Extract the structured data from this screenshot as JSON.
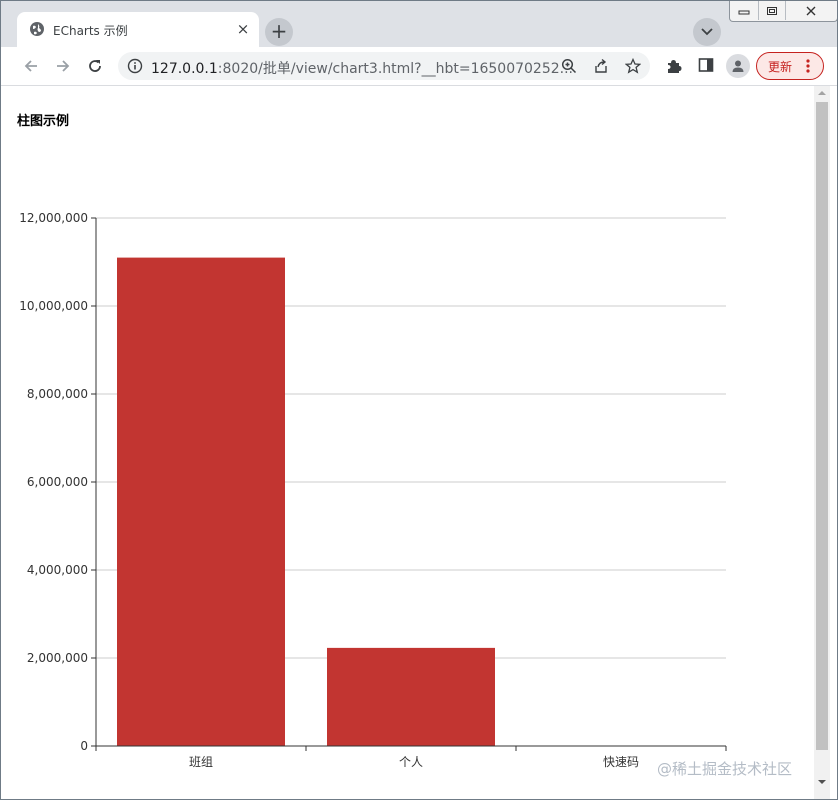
{
  "browser": {
    "tab_title": "ECharts 示例",
    "new_tab_label": "+",
    "close_tab_label": "×",
    "url_host": "127.0.0.1",
    "url_rest": ":8020/批单/view/chart3.html?__hbt=1650070252...",
    "update_label": "更新"
  },
  "page": {
    "heading": "柱图示例"
  },
  "chart_data": {
    "type": "bar",
    "categories": [
      "班组",
      "个人",
      "快速码"
    ],
    "values": [
      11100000,
      2230000,
      0
    ],
    "ylim": [
      0,
      12000000
    ],
    "yticks": [
      0,
      2000000,
      4000000,
      6000000,
      8000000,
      10000000,
      12000000
    ],
    "ytick_labels": [
      "0",
      "2,000,000",
      "4,000,000",
      "6,000,000",
      "8,000,000",
      "10,000,000",
      "12,000,000"
    ],
    "grid": true,
    "bar_color": "#c23531"
  },
  "watermark": "@稀土掘金技术社区",
  "colors": {
    "accent_update": "#c5221f",
    "tab_strip": "#dee1e6"
  }
}
